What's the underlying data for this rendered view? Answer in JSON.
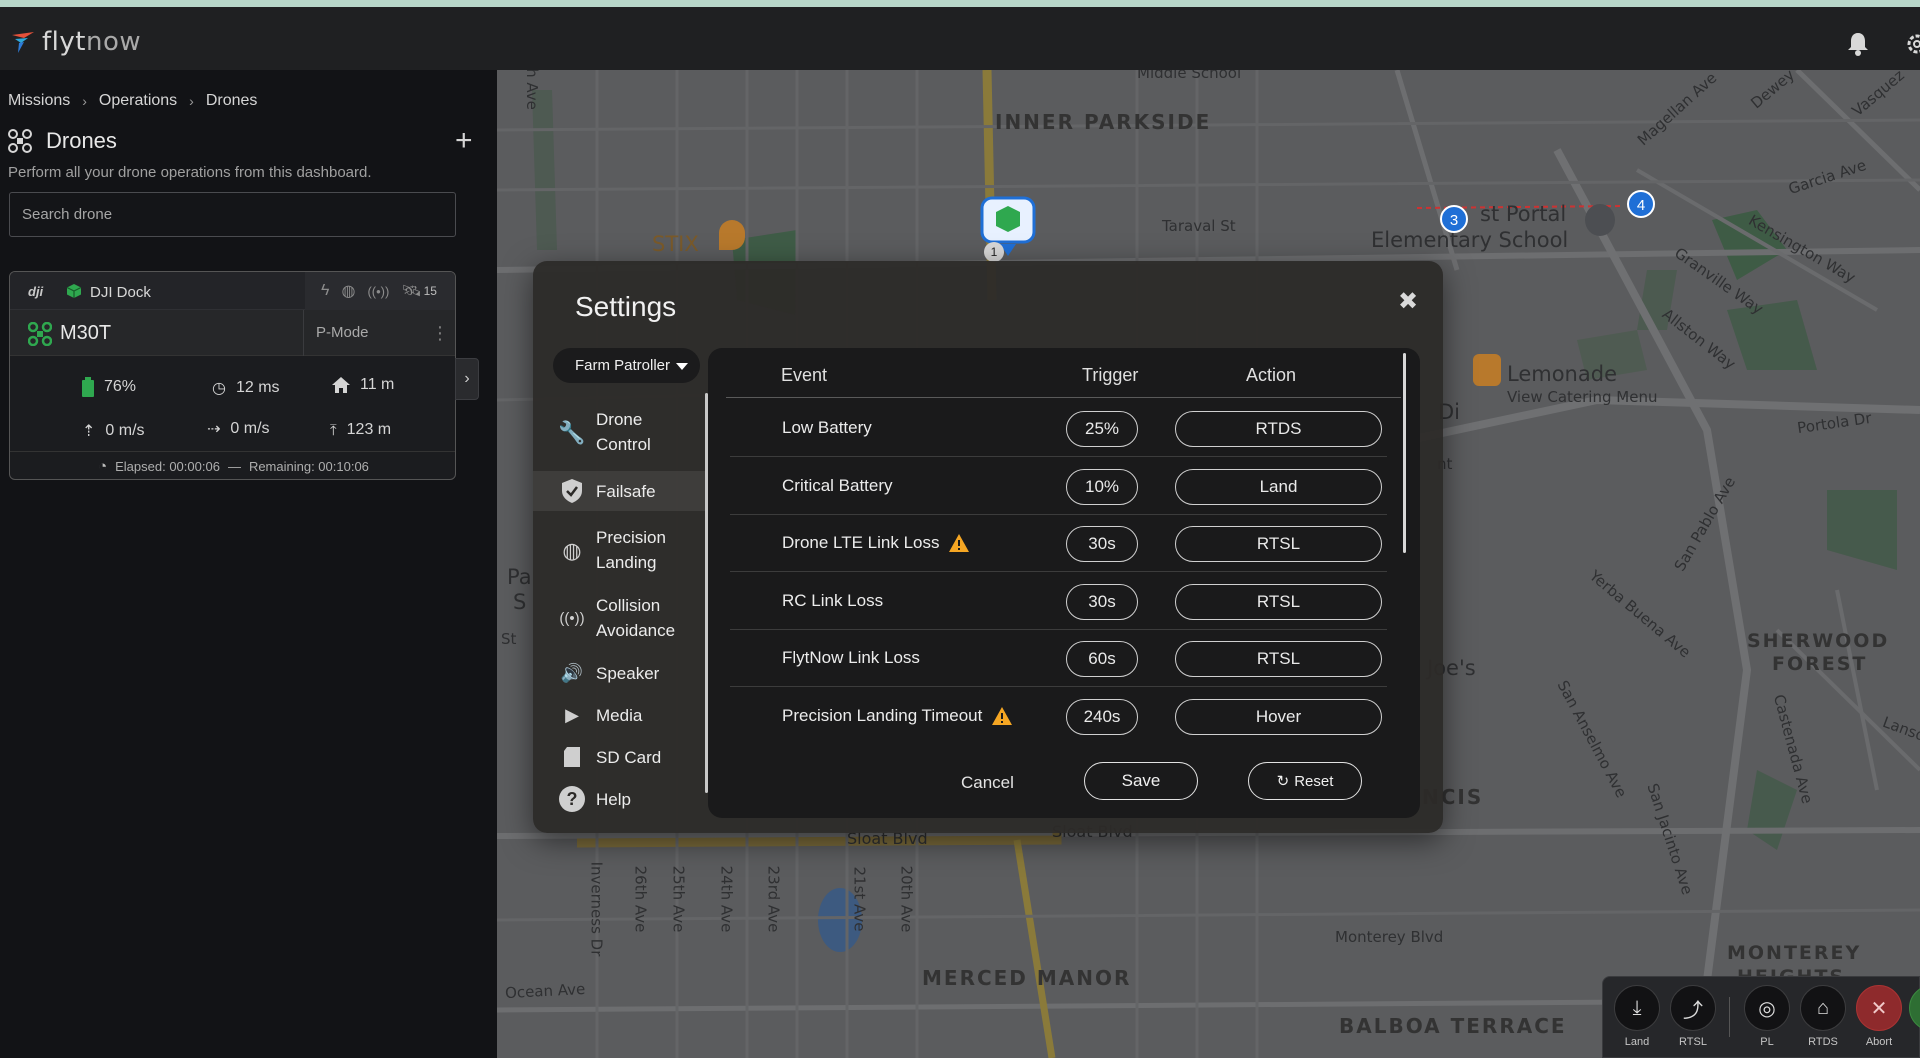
{
  "app": {
    "name_part1": "flyt",
    "name_part2": "now"
  },
  "breadcrumb": [
    "Missions",
    "Operations",
    "Drones"
  ],
  "drones_panel": {
    "title": "Drones",
    "subtitle": "Perform all your drone operations from this dashboard.",
    "search_placeholder": "Search drone"
  },
  "drone_card": {
    "dock_brand": "dji",
    "dock_name": "DJI Dock",
    "satellites": "15",
    "drone_name": "M30T",
    "mode": "P-Mode",
    "battery": "76%",
    "latency": "12 ms",
    "home_distance": "11 m",
    "vertical_speed": "0 m/s",
    "horizontal_speed": "0 m/s",
    "altitude": "123 m",
    "elapsed": "Elapsed: 00:00:06",
    "dash": "—",
    "remaining": "Remaining: 00:10:06"
  },
  "map_labels": {
    "inner_parkside": "INNER PARKSIDE",
    "taraval": "Taraval St",
    "stix": "STIX",
    "school1": "st Portal",
    "school2": "Elementary School",
    "lemonade": "Lemonade",
    "catering": "View Catering Menu",
    "portola": "Portola Dr",
    "sherwood1": "SHERWOOD",
    "sherwood2": "FOREST",
    "joes": "Joe's",
    "ncis": "NCIS",
    "sloat": "Sloat Blvd",
    "sloat2": "Sloat Blvd",
    "merced": "MERCED MANOR",
    "balboa": "BALBOA TERRACE",
    "monterey1": "MONTEREY",
    "monterey2": "HEIGHTS",
    "monterey_blvd": "Monterey Blvd",
    "ocean": "Ocean Ave",
    "garcia": "Garcia Ave",
    "magellan": "Magellan Ave",
    "kensington": "Kensington Way",
    "granville": "Granville Way",
    "allston": "Allston Way",
    "sanpablo": "San Pablo Ave",
    "yerba": "Yerba Buena Ave",
    "sananselmo": "San Anselmo Ave",
    "sanjacinto": "San Jacinto Ave",
    "castenada": "Castenada Ave",
    "ave26": "26th Ave",
    "ave25": "25th Ave",
    "ave24": "24th Ave",
    "ave23": "23rd Ave",
    "ave21": "21st Ave",
    "ave20": "20th Ave",
    "inverness": "Inverness Dr",
    "middle": "Middle School",
    "pin1": "1",
    "pin3": "3",
    "pin4": "4",
    "dewey": "Dewey",
    "vasquez": "Vasquez",
    "di": "Di",
    "pa": "Pa",
    "s": "S",
    "st": "St",
    "ave_top": "h Ave",
    "nt": "nt",
    "lansd": "Lansd"
  },
  "settings": {
    "title": "Settings",
    "profile": "Farm Patroller",
    "menu": [
      {
        "label": "Drone Control"
      },
      {
        "label": "Failsafe"
      },
      {
        "label": "Precision Landing"
      },
      {
        "label": "Collision Avoidance"
      },
      {
        "label": "Speaker"
      },
      {
        "label": "Media"
      },
      {
        "label": "SD Card"
      },
      {
        "label": "Help"
      }
    ],
    "table": {
      "headers": {
        "event": "Event",
        "trigger": "Trigger",
        "action": "Action"
      },
      "rows": [
        {
          "event": "Low Battery",
          "trigger": "25%",
          "action": "RTDS",
          "warning": false
        },
        {
          "event": "Critical Battery",
          "trigger": "10%",
          "action": "Land",
          "warning": false
        },
        {
          "event": "Drone LTE Link Loss",
          "trigger": "30s",
          "action": "RTSL",
          "warning": true
        },
        {
          "event": "RC Link Loss",
          "trigger": "30s",
          "action": "RTSL",
          "warning": false
        },
        {
          "event": "FlytNow Link Loss",
          "trigger": "60s",
          "action": "RTSL",
          "warning": false
        },
        {
          "event": "Precision Landing Timeout",
          "trigger": "240s",
          "action": "Hover",
          "warning": true
        }
      ]
    },
    "buttons": {
      "cancel": "Cancel",
      "save": "Save",
      "reset": "Reset"
    }
  },
  "action_bar": [
    {
      "label": "Land",
      "icon": "land-icon"
    },
    {
      "label": "RTSL",
      "icon": "rtsl-icon"
    },
    {
      "label": "PL",
      "icon": "precision-landing-icon"
    },
    {
      "label": "RTDS",
      "icon": "rtds-icon"
    },
    {
      "label": "Abort",
      "icon": "abort-icon"
    }
  ],
  "colors": {
    "accent_green": "#2fa84f",
    "warning": "#f5a623",
    "abort_red": "#8e2a2c",
    "marker_blue": "#1f6fd6"
  }
}
